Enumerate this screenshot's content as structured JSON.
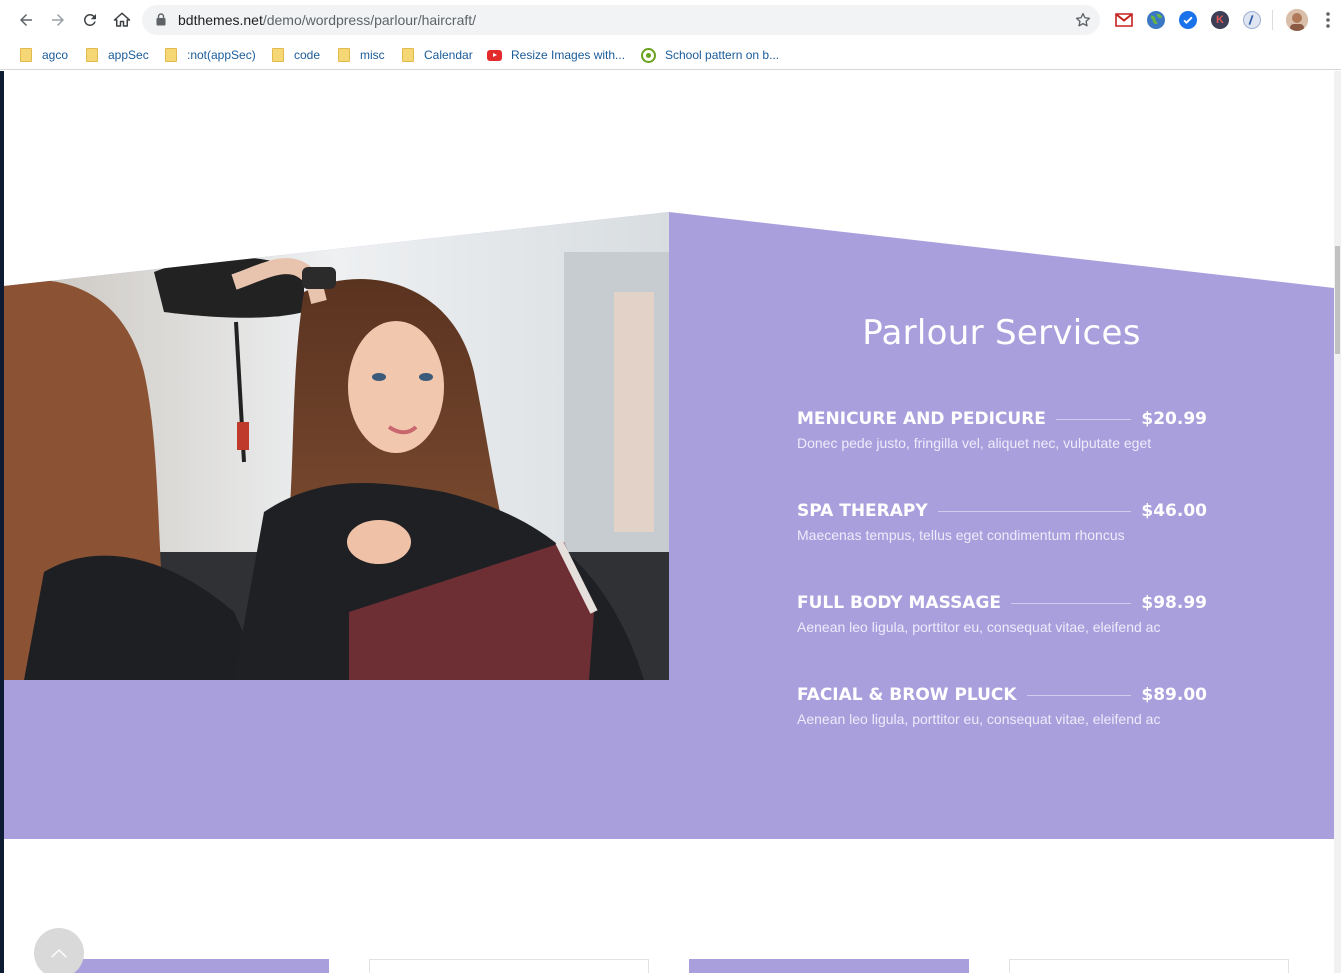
{
  "browser": {
    "url_host": "bdthemes.net",
    "url_path": "/demo/wordpress/parlour/haircraft/",
    "bookmarks": [
      {
        "label": "agco",
        "type": "folder"
      },
      {
        "label": "appSec",
        "type": "folder"
      },
      {
        "label": ":not(appSec)",
        "type": "folder"
      },
      {
        "label": "code",
        "type": "folder"
      },
      {
        "label": "misc",
        "type": "folder"
      },
      {
        "label": "Calendar",
        "type": "folder"
      },
      {
        "label": "Resize Images with...",
        "type": "youtube"
      },
      {
        "label": "School pattern on b...",
        "type": "site"
      }
    ],
    "extensions": [
      "gmail-icon",
      "globe-icon",
      "check-badge-icon",
      "k-extension-icon",
      "bubble-extension-icon"
    ],
    "extension_glyphs": {
      "k": "K"
    }
  },
  "services": {
    "title": "Parlour Services",
    "accent_color": "#a99fdd",
    "items": [
      {
        "name": "MENICURE AND PEDICURE",
        "price": "$20.99",
        "desc": "Donec pede justo, fringilla vel, aliquet nec, vulputate eget"
      },
      {
        "name": "SPA THERAPY",
        "price": "$46.00",
        "desc": "Maecenas tempus, tellus eget condimentum rhoncus"
      },
      {
        "name": "FULL BODY MASSAGE",
        "price": "$98.99",
        "desc": "Aenean leo ligula, porttitor eu, consequat vitae, eleifend ac"
      },
      {
        "name": "FACIAL & BROW PLUCK",
        "price": "$89.00",
        "desc": "Aenean leo ligula, porttitor eu, consequat vitae, eleifend ac"
      }
    ]
  }
}
